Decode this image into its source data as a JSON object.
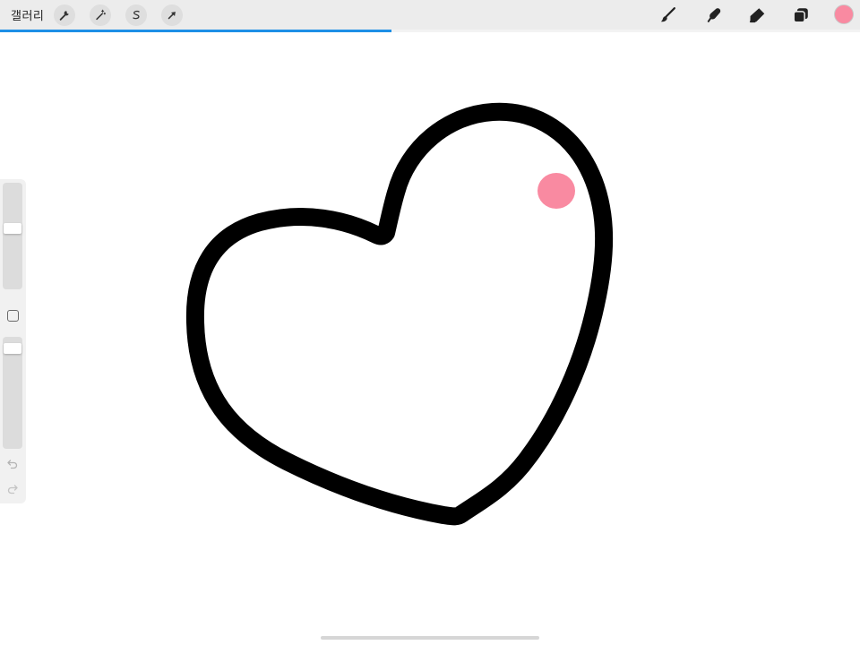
{
  "toolbar": {
    "gallery_label": "갤러리",
    "left_tools": [
      {
        "name": "actions",
        "icon": "wrench-icon"
      },
      {
        "name": "adjustments",
        "icon": "magic-wand-icon"
      },
      {
        "name": "selection",
        "icon": "selection-s-icon"
      },
      {
        "name": "transform",
        "icon": "arrow-cursor-icon"
      }
    ],
    "right_tools": [
      {
        "name": "paint",
        "icon": "brush-icon"
      },
      {
        "name": "smudge",
        "icon": "smudge-finger-icon"
      },
      {
        "name": "erase",
        "icon": "eraser-icon"
      },
      {
        "name": "layers",
        "icon": "layers-icon"
      }
    ],
    "current_color": "#f98aa1"
  },
  "progress": {
    "value": 0.455,
    "color": "#1e8fe6"
  },
  "sidebar": {
    "brush_size": 0.58,
    "brush_opacity": 0.94,
    "modify_icon": "square-icon",
    "undo_icon": "undo-arrow-icon",
    "redo_icon": "redo-arrow-icon"
  },
  "artwork": {
    "outline_color": "#000000",
    "dot_color": "#f98aa1"
  }
}
